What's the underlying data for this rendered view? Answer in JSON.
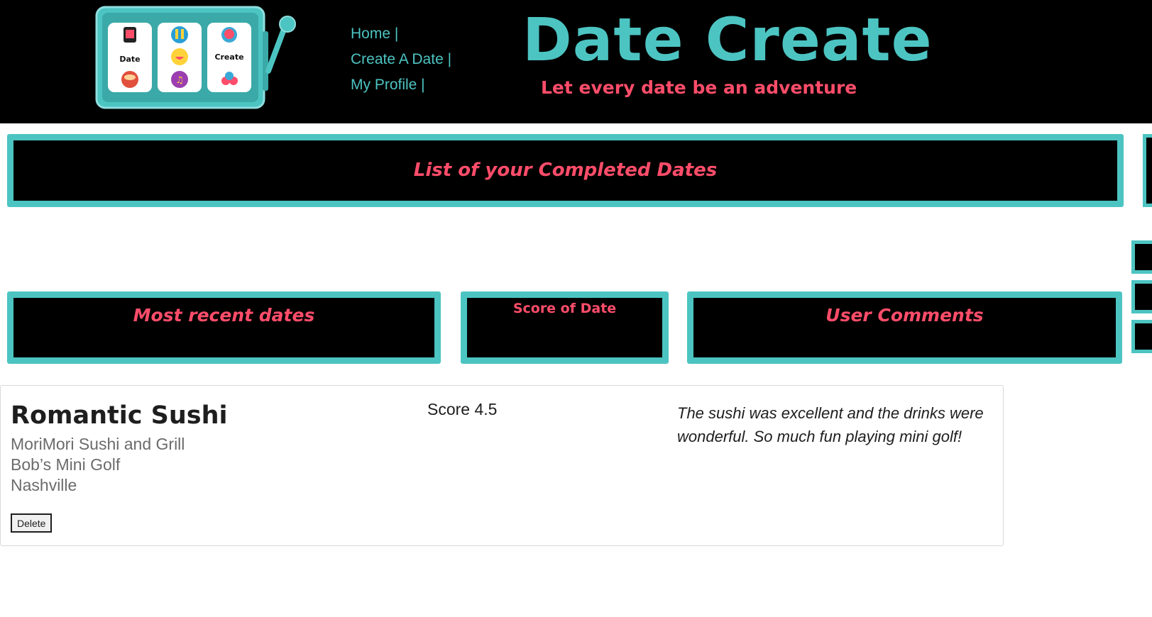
{
  "header": {
    "logo": {
      "reel_labels": [
        "Date",
        "Create"
      ]
    },
    "nav": [
      {
        "label": "Home |"
      },
      {
        "label": "Create A Date |"
      },
      {
        "label": "My Profile |"
      }
    ],
    "title": "Date Create",
    "tagline": "Let every date be an adventure"
  },
  "main": {
    "page_heading": "List of your Completed Dates",
    "columns": {
      "recent": "Most recent dates",
      "score": "Score of Date",
      "comments": "User Comments"
    },
    "dates": [
      {
        "title": "Romantic Sushi",
        "places": [
          "MoriMori Sushi and Grill",
          "Bob’s Mini Golf",
          "Nashville"
        ],
        "score_text": "Score 4.5",
        "comment": "The sushi was excellent and the drinks were wonderful. So much fun playing mini golf!",
        "delete_label": "Delete"
      }
    ]
  },
  "colors": {
    "accent": "#4cc4c2",
    "highlight": "#ff4d6a",
    "header_bg": "#000000"
  }
}
